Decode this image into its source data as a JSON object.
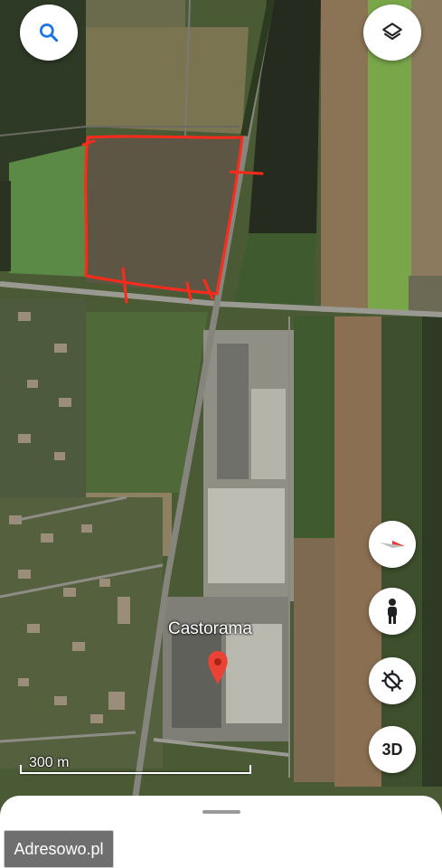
{
  "map": {
    "type": "satellite",
    "place_label": "Castorama",
    "scale_label": "300 m",
    "marker_color": "#ea4335",
    "annotation_color": "#ff2a1a"
  },
  "controls": {
    "search_icon": "search-icon",
    "layers_icon": "layers-icon",
    "compass_icon": "compass-icon",
    "street_view_icon": "pegman-icon",
    "location_icon": "location-off-icon",
    "three_d_label": "3D"
  },
  "watermark": {
    "text": "Adresowo.pl"
  },
  "colors": {
    "accent": "#1a73e8",
    "sheet": "#ffffff"
  }
}
